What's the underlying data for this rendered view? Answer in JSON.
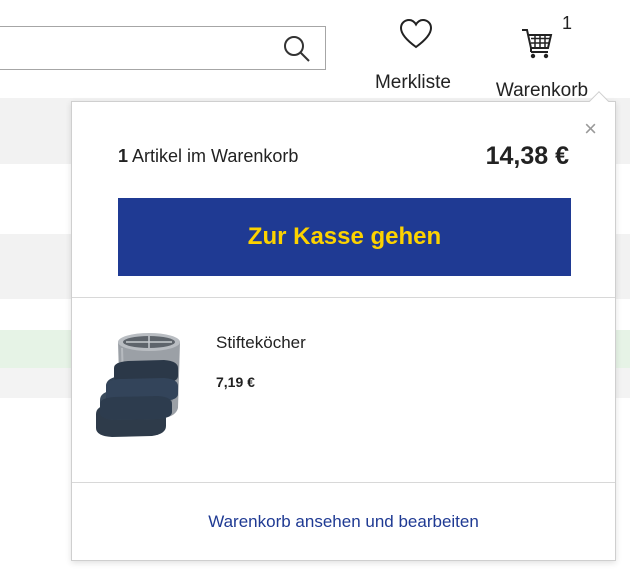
{
  "header": {
    "search": {
      "value": "",
      "placeholder": ""
    },
    "wishlist_label": "Merkliste",
    "cart_label": "Warenkorb",
    "cart_badge": "1"
  },
  "mini_cart": {
    "count": "1",
    "count_text": " Artikel im Warenkorb",
    "total": "14,38 €",
    "checkout_label": "Zur Kasse gehen",
    "close_symbol": "×",
    "items": [
      {
        "name": "Stifteköcher",
        "price": "7,19 €",
        "image_icon": "pen-holder-image"
      }
    ],
    "view_cart_label": "Warenkorb ansehen und bearbeiten"
  },
  "colors": {
    "brand_blue": "#1f3a93",
    "checkout_text": "#fcd200"
  }
}
